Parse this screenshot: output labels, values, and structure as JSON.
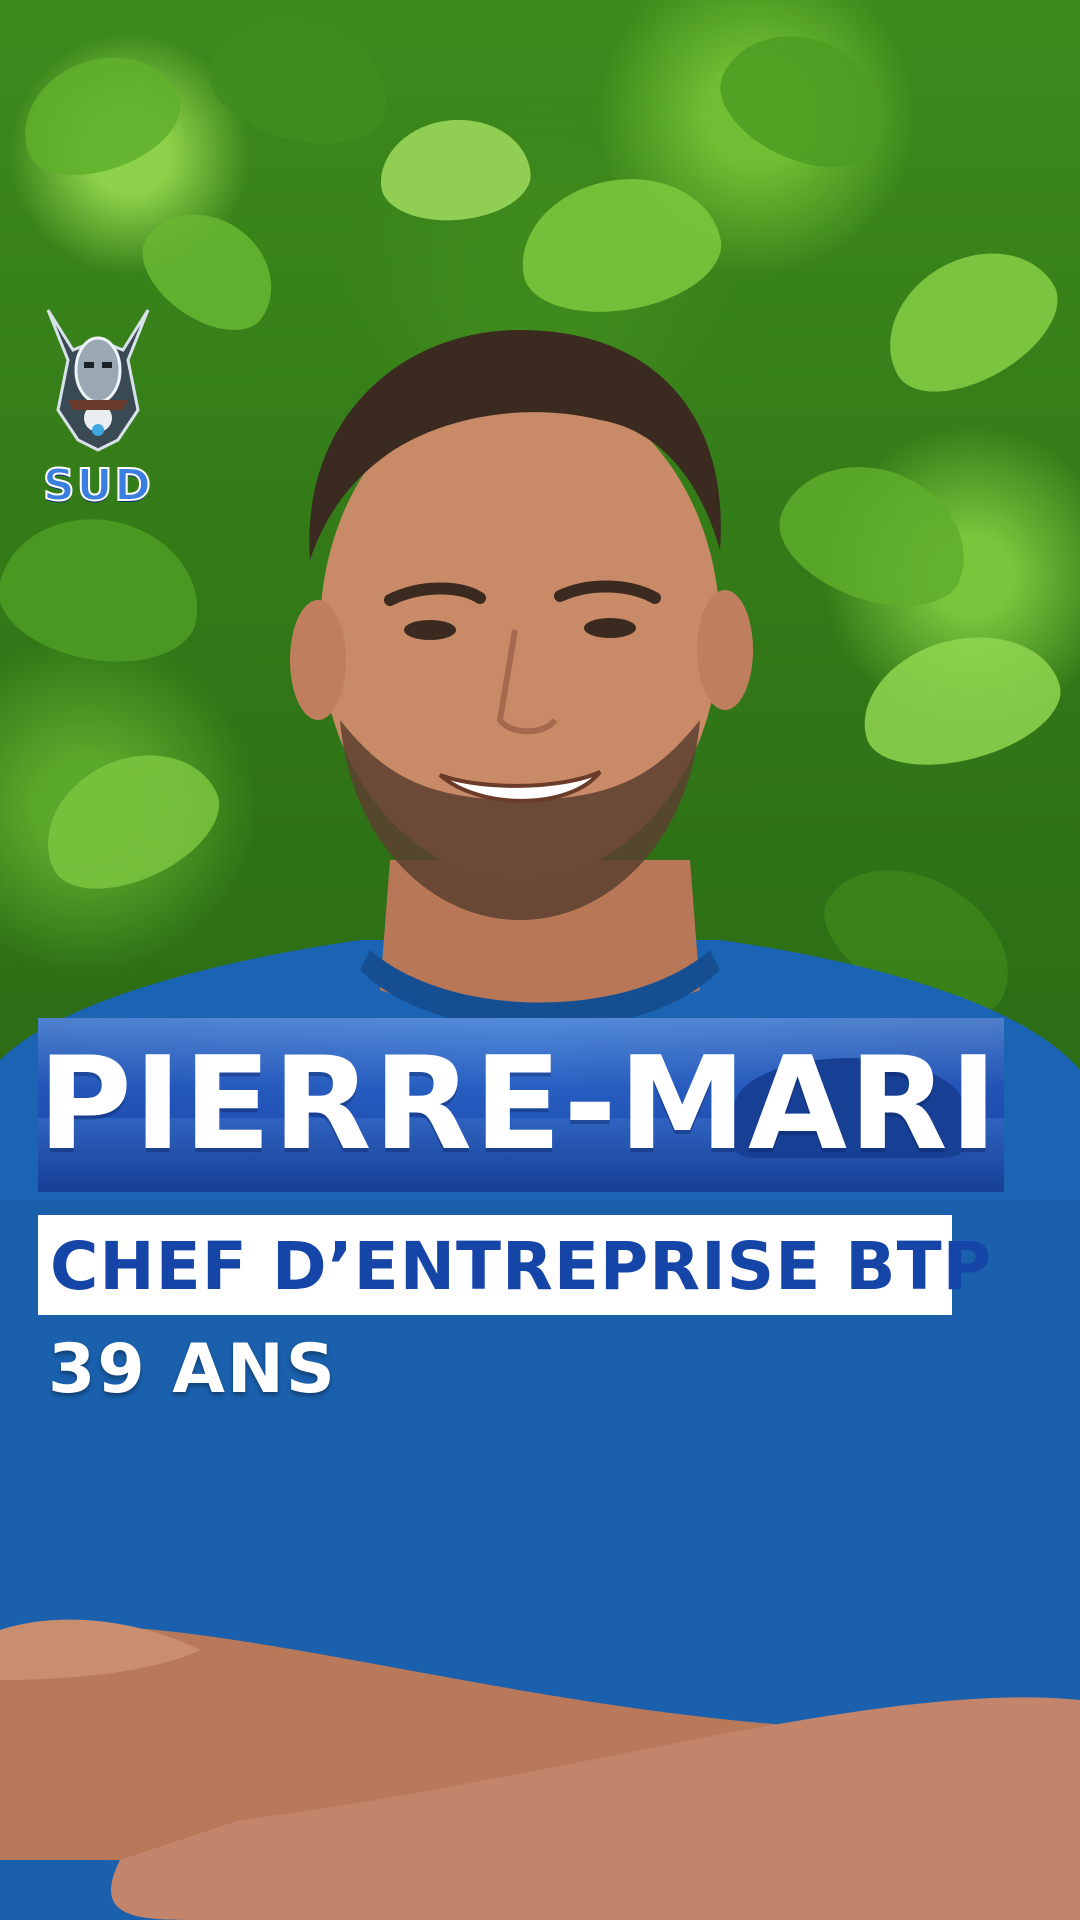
{
  "logo": {
    "text": "SUD",
    "icon": "tribal-mask-icon"
  },
  "candidate": {
    "name": "PIERRE-MARIE",
    "occupation": "CHEF D’ENTREPRISE BTP",
    "age": "39 ANS"
  },
  "colors": {
    "accent_blue": "#1645a8",
    "banner_blue": "#2a66c8",
    "foliage_green": "#3d8a1c",
    "shirt_blue": "#1b64b4",
    "skin": "#c98a68"
  }
}
